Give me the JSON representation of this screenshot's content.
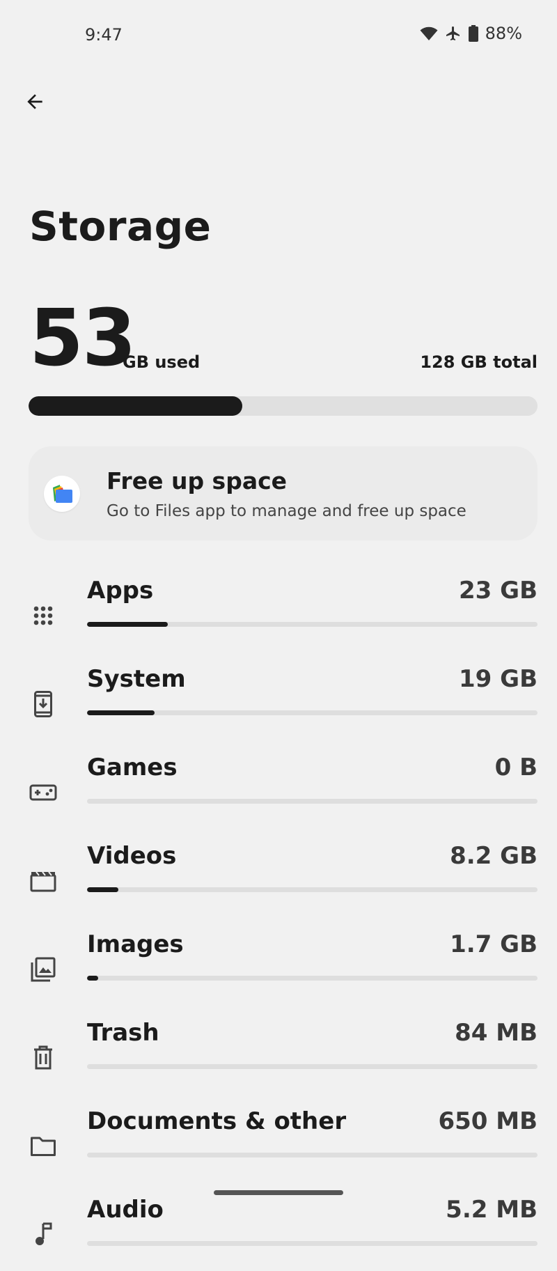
{
  "status_bar": {
    "time": "9:47",
    "battery": "88%",
    "icons": [
      "wifi-icon",
      "airplane-icon",
      "battery-icon"
    ]
  },
  "header": {
    "back_icon": "arrow-back-icon",
    "title": "Storage"
  },
  "summary": {
    "used_number": "53",
    "used_unit": "GB used",
    "total": "128 GB total",
    "used_fraction": 0.42
  },
  "free_up": {
    "title": "Free up space",
    "subtitle": "Go to Files app to manage and free up space",
    "icon": "files-app-icon"
  },
  "categories": [
    {
      "label": "Apps",
      "size": "23 GB",
      "icon": "apps-grid-icon",
      "fraction": 0.18
    },
    {
      "label": "System",
      "size": "19 GB",
      "icon": "system-update-icon",
      "fraction": 0.15
    },
    {
      "label": "Games",
      "size": "0 B",
      "icon": "gamepad-icon",
      "fraction": 0.0
    },
    {
      "label": "Videos",
      "size": "8.2 GB",
      "icon": "movie-clapper-icon",
      "fraction": 0.07
    },
    {
      "label": "Images",
      "size": "1.7 GB",
      "icon": "image-icon",
      "fraction": 0.025
    },
    {
      "label": "Trash",
      "size": "84 MB",
      "icon": "trash-icon",
      "fraction": 0.0
    },
    {
      "label": "Documents & other",
      "size": "650 MB",
      "icon": "folder-icon",
      "fraction": 0.0
    },
    {
      "label": "Audio",
      "size": "5.2 MB",
      "icon": "music-note-icon",
      "fraction": 0.0
    }
  ],
  "colors": {
    "background": "#f1f1f1",
    "bar_fill": "#1b1b1b",
    "bar_track": "#e0e0e0",
    "card": "#ebebeb"
  }
}
